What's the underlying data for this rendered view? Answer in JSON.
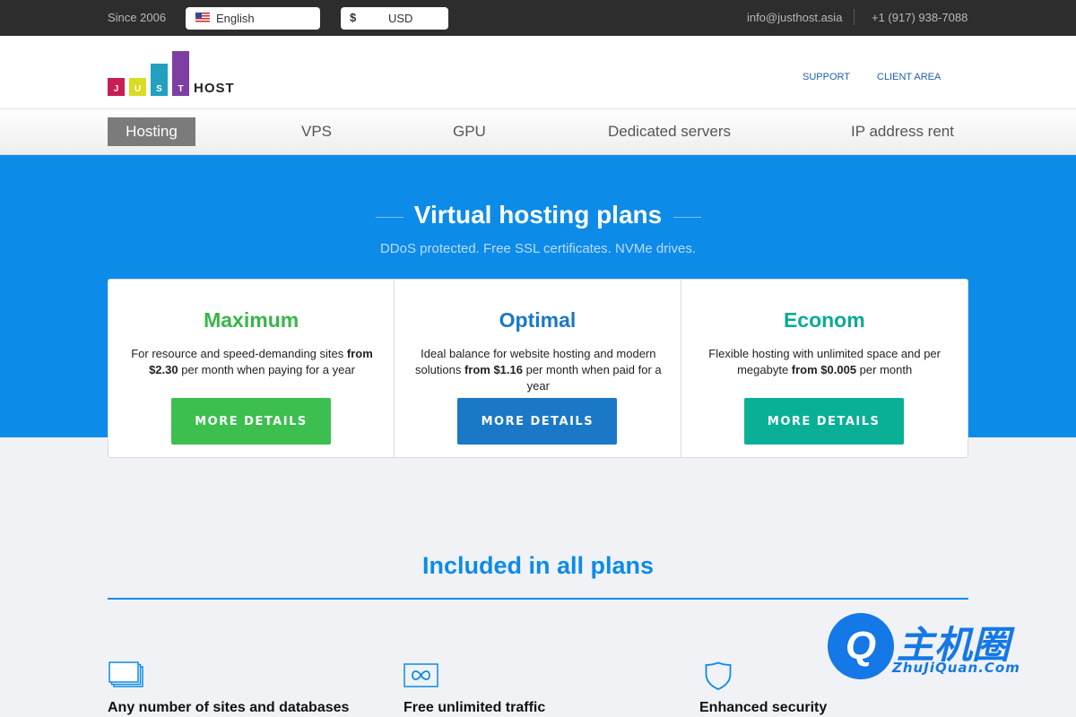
{
  "topbar": {
    "since": "Since 2006",
    "language": {
      "label": "English",
      "icon": "us-flag-icon"
    },
    "currency": {
      "symbol": "$",
      "label": "USD"
    },
    "email": "info@justhost.asia",
    "phone": "+1 (917) 938-7088"
  },
  "header": {
    "logo": {
      "letters": [
        "J",
        "U",
        "S",
        "T"
      ],
      "word": "HOST"
    },
    "nav": {
      "support": "SUPPORT",
      "client_area": "CLIENT AREA"
    }
  },
  "tabs": [
    {
      "label": "Hosting",
      "active": true
    },
    {
      "label": "VPS"
    },
    {
      "label": "GPU"
    },
    {
      "label": "Dedicated servers"
    },
    {
      "label": "IP address rent"
    }
  ],
  "hero": {
    "title": "Virtual hosting plans",
    "subtitle": "DDoS protected. Free SSL certificates. NVMe drives."
  },
  "plans": [
    {
      "name": "Maximum",
      "color": "#3ab54a",
      "desc_before": "For resource and speed-demanding sites ",
      "price": "from $2.30",
      "desc_after": " per month when paying for a year",
      "button": "MORE DETAILS",
      "button_color": "#3cbf4e"
    },
    {
      "name": "Optimal",
      "color": "#1a78c7",
      "desc_before": "Ideal balance for website hosting and modern solutions ",
      "price": "from $1.16",
      "desc_after": " per month when paid for a year",
      "button": "MORE DETAILS",
      "button_color": "#1a78c7"
    },
    {
      "name": "Econom",
      "color": "#0aab93",
      "desc_before": "Flexible hosting with unlimited space and per megabyte ",
      "price": "from $0.005",
      "desc_after": " per month",
      "button": "MORE DETAILS",
      "button_color": "#0ab096"
    }
  ],
  "included": {
    "title": "Included in all plans",
    "features": [
      {
        "label": "Any number of sites and databases",
        "icon": "stacked-windows-icon"
      },
      {
        "label": "Free unlimited traffic",
        "icon": "infinity-icon"
      },
      {
        "label": "Enhanced security",
        "icon": "shield-icon"
      }
    ]
  },
  "watermark": {
    "logo_letter": "Q",
    "text": "主机圈",
    "sub": "ZhuJiQuan.Com"
  },
  "colors": {
    "accent": "#0d8be8",
    "topbar": "#2d2d2d",
    "watermark": "#1478e6"
  }
}
